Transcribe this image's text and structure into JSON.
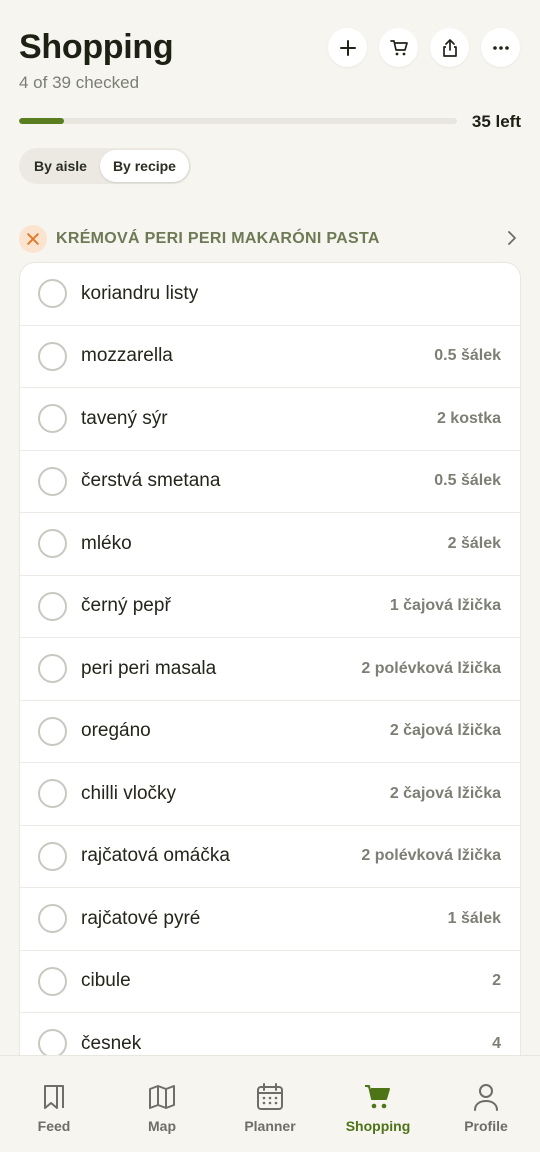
{
  "header": {
    "title": "Shopping",
    "subtitle": "4 of 39 checked",
    "left_count": "35 left",
    "progress_fraction": 0.103
  },
  "actions": [
    {
      "icon": "plus-icon"
    },
    {
      "icon": "cart-icon"
    },
    {
      "icon": "share-icon"
    },
    {
      "icon": "more-icon"
    }
  ],
  "toggle": {
    "by_aisle": "By aisle",
    "by_recipe": "By recipe",
    "selected": "By recipe"
  },
  "recipe": {
    "title": "KRÉMOVÁ PERI PERI MAKARÓNI PASTA"
  },
  "items": [
    {
      "name": "koriandru listy",
      "qty": ""
    },
    {
      "name": "mozzarella",
      "qty": "0.5 šálek"
    },
    {
      "name": "tavený sýr",
      "qty": "2 kostka"
    },
    {
      "name": "čerstvá smetana",
      "qty": "0.5 šálek"
    },
    {
      "name": "mléko",
      "qty": "2 šálek"
    },
    {
      "name": "černý pepř",
      "qty": "1 čajová lžička"
    },
    {
      "name": "peri peri masala",
      "qty": "2 polévková lžička"
    },
    {
      "name": "oregáno",
      "qty": "2 čajová lžička"
    },
    {
      "name": "chilli vločky",
      "qty": "2 čajová lžička"
    },
    {
      "name": "rajčatová omáčka",
      "qty": "2 polévková lžička"
    },
    {
      "name": "rajčatové pyré",
      "qty": "1 šálek"
    },
    {
      "name": "cibule",
      "qty": "2"
    },
    {
      "name": "česnek",
      "qty": "4"
    }
  ],
  "nav": {
    "feed": "Feed",
    "map": "Map",
    "planner": "Planner",
    "shopping": "Shopping",
    "profile": "Profile",
    "active": "Shopping"
  },
  "colors": {
    "accent": "#5a7d1f",
    "active_nav": "#4e7418",
    "recipe_title": "#6d7a55"
  }
}
